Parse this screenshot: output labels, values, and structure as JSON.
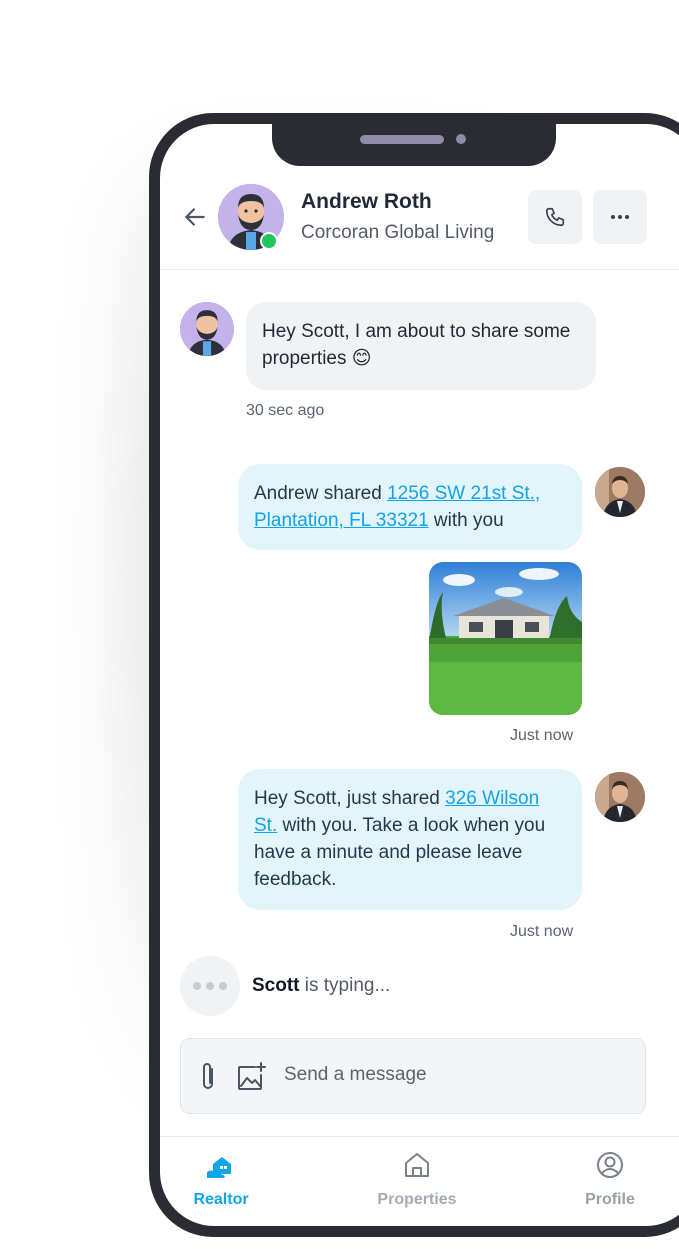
{
  "header": {
    "name": "Andrew Roth",
    "company": "Corcoran Global Living"
  },
  "messages": [
    {
      "text": "Hey Scott, I am about to share some properties 😊",
      "time": "30 sec ago"
    },
    {
      "prefix": "Andrew shared ",
      "link": "1256 SW 21st St., Plantation, FL 33321",
      "suffix": " with you",
      "time": "Just now"
    },
    {
      "prefix": "Hey Scott, just shared ",
      "link": "326 Wilson St.",
      "suffix": " with you. Take a look when you have a minute and please leave feedback.",
      "time": "Just now"
    }
  ],
  "typing": {
    "name": "Scott",
    "text": " is typing..."
  },
  "composer": {
    "placeholder": "Send a message"
  },
  "nav": [
    {
      "label": "Realtor",
      "icon": "realtor-icon"
    },
    {
      "label": "Properties",
      "icon": "home-icon"
    },
    {
      "label": "Profile",
      "icon": "profile-icon"
    }
  ],
  "colors": {
    "accent": "#0ea5e9",
    "online": "#22c55e",
    "outgoing_bubble": "#e4f4fb",
    "incoming_bubble": "#f1f2f4"
  }
}
